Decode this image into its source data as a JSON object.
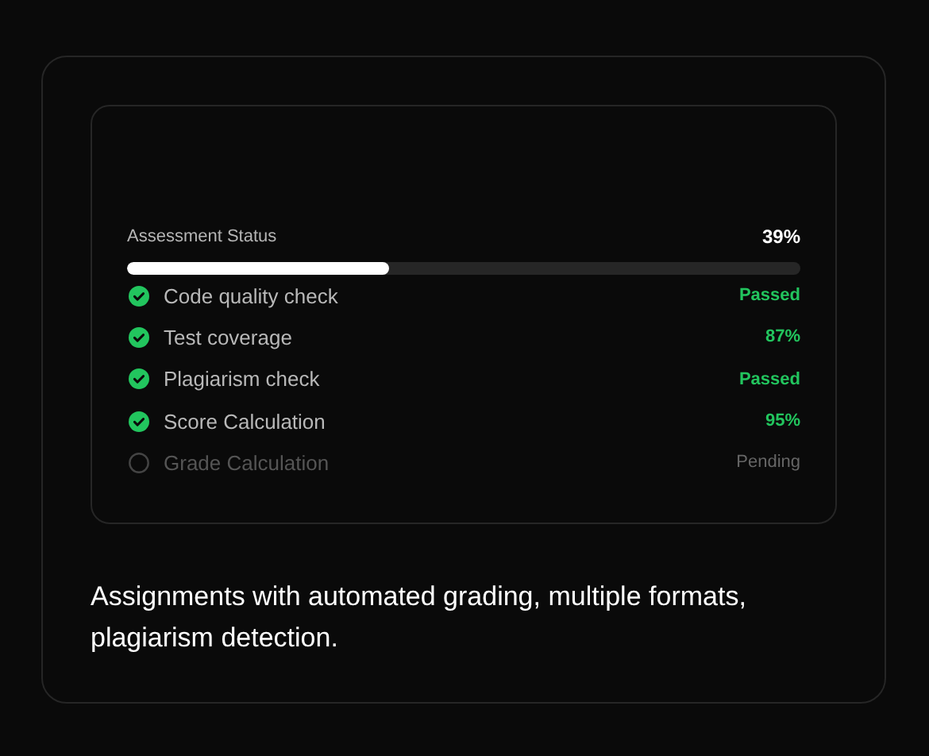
{
  "status": {
    "label": "Assessment Status",
    "value": "39%",
    "level": 0.39
  },
  "checks": [
    {
      "label": "Code quality check",
      "result": "Passed",
      "checked": true
    },
    {
      "label": "Test coverage",
      "result": "87%",
      "checked": true
    },
    {
      "label": "Plagiarism check",
      "result": "Passed",
      "checked": true
    },
    {
      "label": "Score Calculation",
      "result": "95%",
      "checked": true
    },
    {
      "label": "Grade Calculation",
      "result": "Pending",
      "checked": false
    }
  ],
  "description": "Assignments with automated grading, multiple formats, plagiarism detection."
}
